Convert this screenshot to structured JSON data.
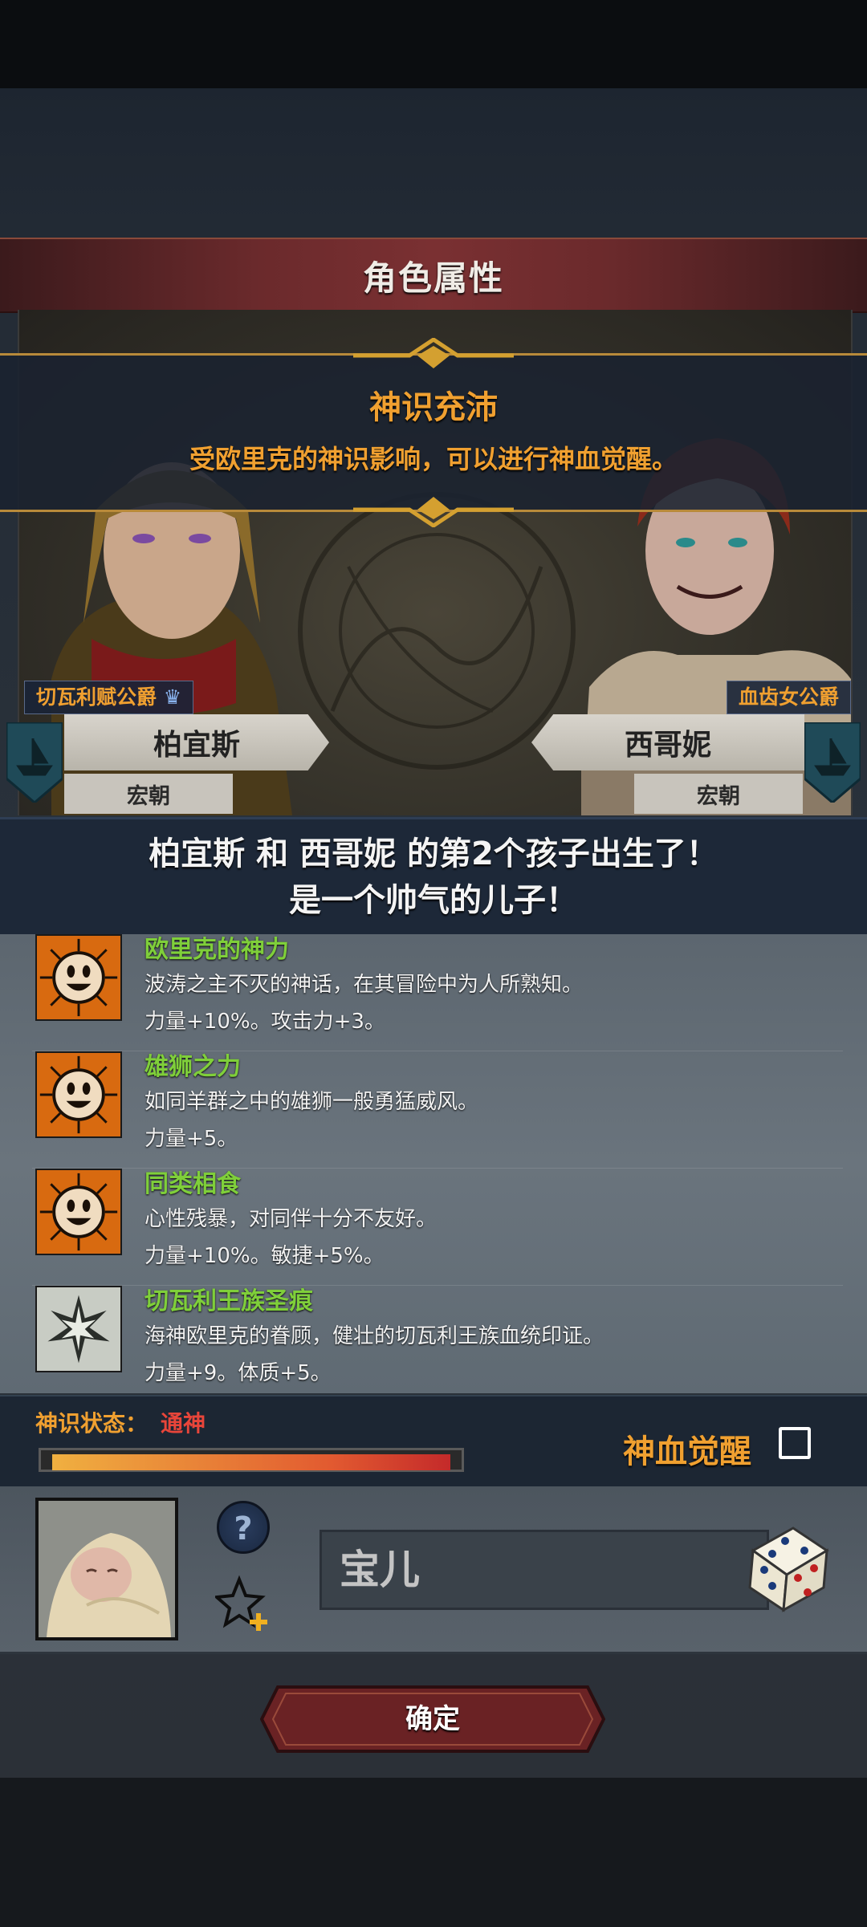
{
  "screen": {
    "title": "角色属性"
  },
  "banner": {
    "title": "神识充沛",
    "subtitle": "受欧里克的神识影响，可以进行神血觉醒。"
  },
  "parents": {
    "left": {
      "title": "切瓦利赋公爵",
      "name": "柏宜斯",
      "dynasty": "宏朝"
    },
    "right": {
      "title": "血齿女公爵",
      "name": "西哥妮",
      "dynasty": "宏朝"
    }
  },
  "announcement": {
    "line1": "柏宜斯 和 西哥妮 的第2个孩子出生了！",
    "line2": "是一个帅气的儿子！"
  },
  "traits": [
    {
      "name": "欧里克的神力",
      "description": "波涛之主不灭的神话，在其冒险中为人所熟知。",
      "effect": "力量+10%。攻击力+3。",
      "icon": "smiley-sun-icon"
    },
    {
      "name": "雄狮之力",
      "description": "如同羊群之中的雄狮一般勇猛威风。",
      "effect": "力量+5。",
      "icon": "smiley-sun-icon"
    },
    {
      "name": "同类相食",
      "description": "心性残暴，对同伴十分不友好。",
      "effect": "力量+10%。敏捷+5%。",
      "icon": "smiley-sun-icon"
    },
    {
      "name": "切瓦利王族圣痕",
      "description": "海神欧里克的眷顾，健壮的切瓦利王族血统印证。",
      "effect": "力量+9。体质+5。",
      "icon": "royal-stigma-icon"
    }
  ],
  "divine_status": {
    "label": "神识状态：",
    "value": "通神",
    "level": 1.0,
    "value_color": "#e8453a"
  },
  "awakening": {
    "label": "神血觉醒",
    "checked": false
  },
  "child": {
    "name_value": "宝儿"
  },
  "confirm": {
    "label": "确定"
  },
  "colors": {
    "accent_gold": "#f0a030",
    "trait_green": "#7fcf3a",
    "title_red": "#6b2a2c"
  }
}
